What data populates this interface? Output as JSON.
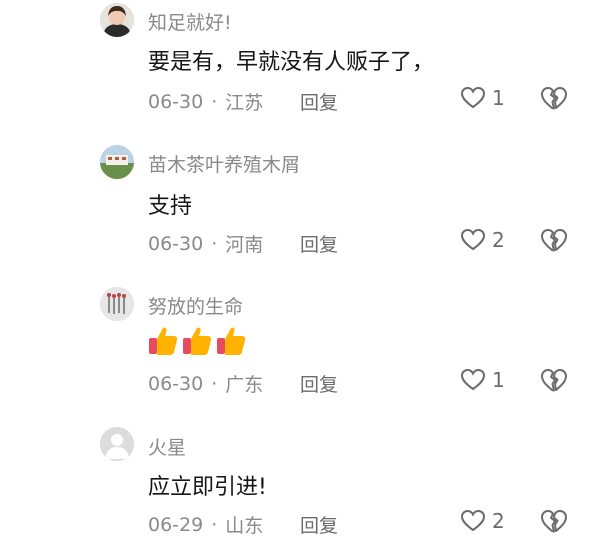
{
  "comments": [
    {
      "user": "知足就好!",
      "text": "要是有，早就没有人贩子了，",
      "date": "06-30",
      "location": "江苏",
      "reply_label": "回复",
      "likes": "1"
    },
    {
      "user": "苗木茶叶养殖木屑",
      "text": "支持",
      "date": "06-30",
      "location": "河南",
      "reply_label": "回复",
      "likes": "2"
    },
    {
      "user": "努放的生命",
      "text": "👍👍👍",
      "date": "06-30",
      "location": "广东",
      "reply_label": "回复",
      "likes": "1"
    },
    {
      "user": "火星",
      "text": "应立即引进!",
      "date": "06-29",
      "location": "山东",
      "reply_label": "回复",
      "likes": "2"
    }
  ],
  "separator": "·",
  "colors": {
    "text": "#161616",
    "muted": "#8a8a8a",
    "icon": "#6b6b6b",
    "thumb": "#ffb300"
  },
  "icons": {
    "like": "heart-icon",
    "dislike": "broken-heart-icon",
    "thumbs_up": "thumbs-up-icon"
  }
}
